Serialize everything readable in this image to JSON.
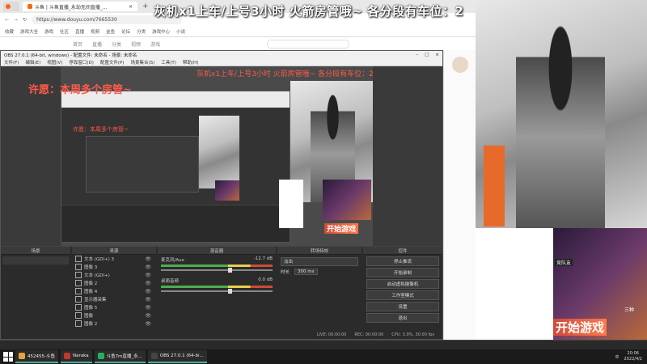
{
  "overlay": {
    "top_title": "灰机x1上车/上号3小时   火箭房管哦~   各分段有车位：2",
    "inner_title": "灰机x1上车/上号3小时   火箭房管哦~   各分段有车位：2",
    "wish": "许愿：本周多个房管~",
    "wish_small": "许愿：本周多个房管~"
  },
  "browser": {
    "tab_active": "斗鱼 | 斗鱼直播_永劫无间直播_...",
    "tab_close": "×",
    "tab_new": "+",
    "url": "https://www.douyu.com/7665530",
    "bookmarks": [
      "收藏",
      "游戏大全",
      "游戏",
      "社区",
      "直播",
      "视频",
      "金鱼",
      "论坛",
      "分类",
      "游戏中心",
      "小说"
    ],
    "nav_items": [
      "首页",
      "直播",
      "分类",
      "视频",
      "游戏"
    ]
  },
  "obs": {
    "title": "OBS 27.0.1 (64-bit, windows) - 配置文件: 未命名 - 场景: 未命名",
    "menu": [
      "文件(F)",
      "编辑(E)",
      "视图(V)",
      "停靠窗口(D)",
      "配置文件(P)",
      "场景集合(S)",
      "工具(T)",
      "帮助(H)"
    ],
    "panels": {
      "scenes": "场景",
      "sources": "来源",
      "mixer": "混音器",
      "transitions": "转场特效",
      "controls": "控件"
    },
    "sources": [
      "文本 (GDI+) 3",
      "图像 3",
      "文本 (GDI+)",
      "图像 2",
      "图像 4",
      "显示器采集",
      "图像 5",
      "图像",
      "图像 2"
    ],
    "mixer": [
      {
        "name": "麦克风/Aux",
        "level": "-12.7 dB"
      },
      {
        "name": "桌面音频",
        "level": "0.0 dB"
      }
    ],
    "transition": {
      "type": "淡出",
      "duration_label": "时长",
      "duration": "300 ms"
    },
    "controls": [
      "停止推流",
      "开始录制",
      "启动虚拟摄像机",
      "工作室模式",
      "设置",
      "退出"
    ],
    "status": {
      "live": "LIVE: 00:00:00",
      "rec": "REC: 00:00:00",
      "cpu": "CPU: 3.9%, 30.00 fps"
    },
    "game_label": "开始游戏"
  },
  "right": {
    "game_label": "开始游戏",
    "team_label": "竞队友",
    "tag": "三种"
  },
  "taskbar": {
    "items": [
      {
        "label": "452455-斗鱼",
        "color": "#e6a23c"
      },
      {
        "label": "Naraka",
        "color": "#c0392b"
      },
      {
        "label": "斗鱼7m直播_永...",
        "color": "#27ae60"
      },
      {
        "label": "OBS 27.0.1 (64-bi...",
        "color": "#444"
      }
    ],
    "time": "20:06",
    "date": "2022/4/2",
    "lang": "中"
  }
}
